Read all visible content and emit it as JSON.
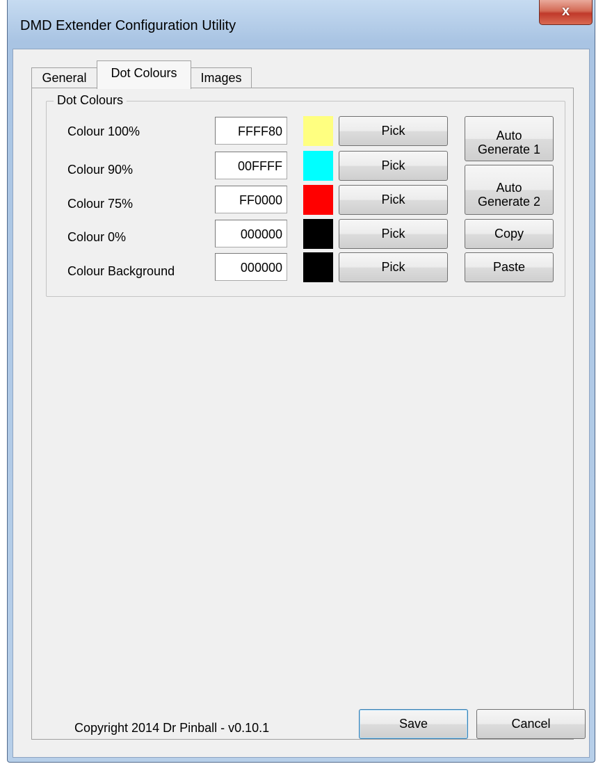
{
  "window": {
    "title": "DMD Extender Configuration Utility",
    "close_glyph": "x"
  },
  "tabs": [
    {
      "label": "General",
      "active": false
    },
    {
      "label": "Dot Colours",
      "active": true
    },
    {
      "label": "Images",
      "active": false
    }
  ],
  "dot_colours": {
    "legend": "Dot Colours",
    "rows": [
      {
        "label": "Colour 100%",
        "hex": "FFFF80",
        "swatch": "#FFFF80",
        "pick_label": "Pick"
      },
      {
        "label": "Colour 90%",
        "hex": "00FFFF",
        "swatch": "#00FFFF",
        "pick_label": "Pick"
      },
      {
        "label": "Colour 75%",
        "hex": "FF0000",
        "swatch": "#FF0000",
        "pick_label": "Pick"
      },
      {
        "label": "Colour 0%",
        "hex": "000000",
        "swatch": "#000000",
        "pick_label": "Pick"
      },
      {
        "label": "Colour Background",
        "hex": "000000",
        "swatch": "#000000",
        "pick_label": "Pick"
      }
    ],
    "auto_generate_1": {
      "line1": "Auto",
      "line2": "Generate 1"
    },
    "auto_generate_2": {
      "line1": "Auto",
      "line2": "Generate 2"
    },
    "copy_label": "Copy",
    "paste_label": "Paste"
  },
  "footer": {
    "copyright": "Copyright 2014 Dr Pinball - v0.10.1",
    "save_label": "Save",
    "cancel_label": "Cancel"
  }
}
